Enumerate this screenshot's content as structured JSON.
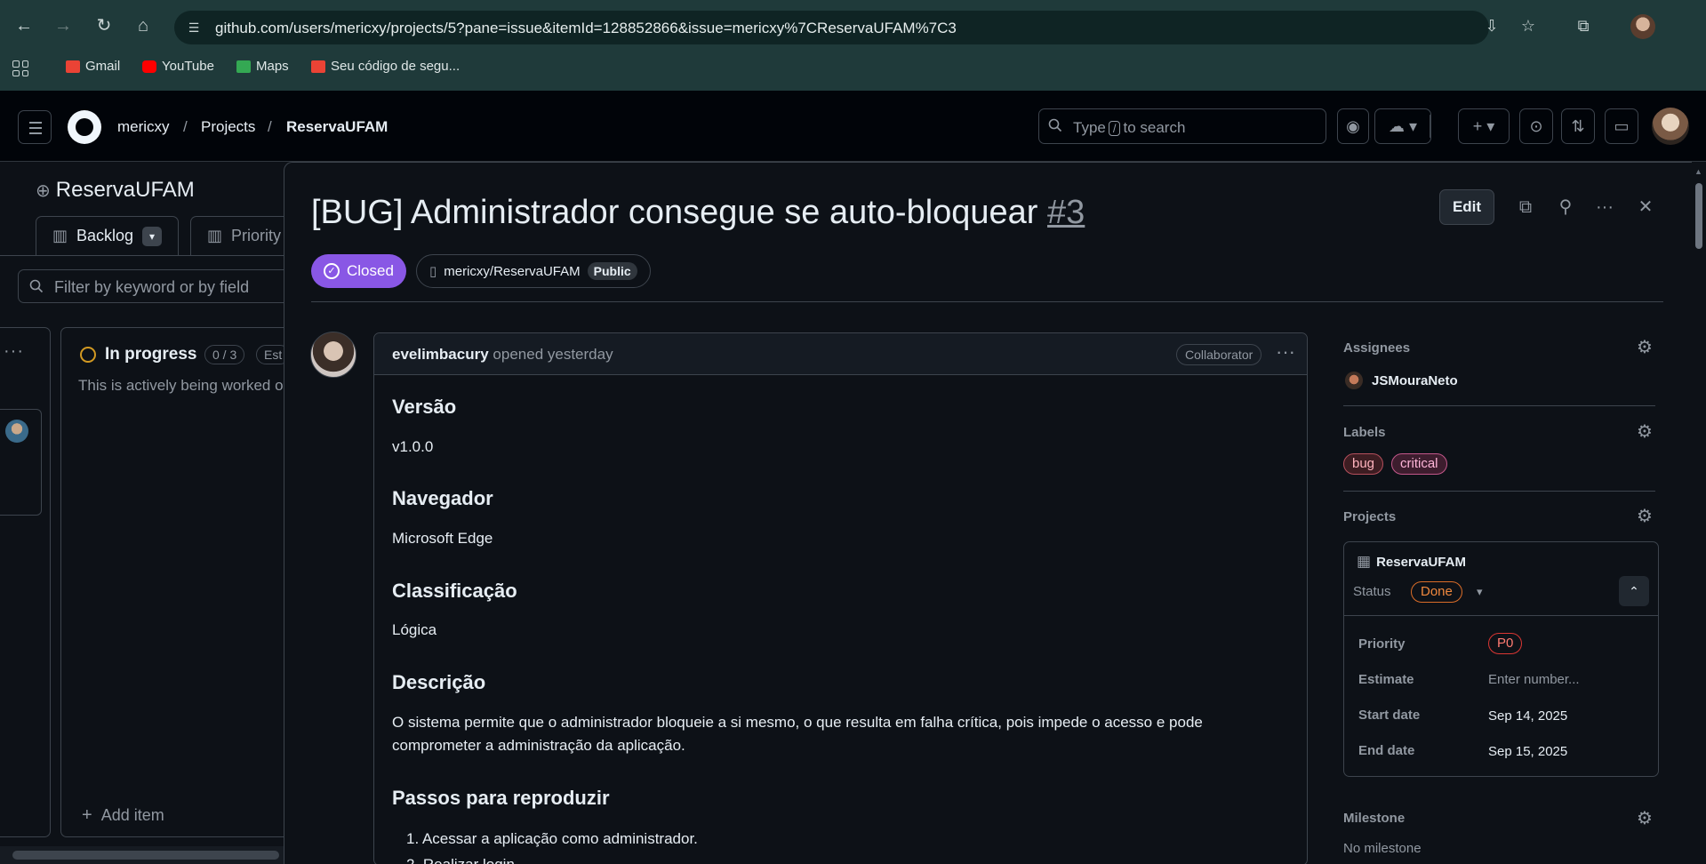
{
  "browser": {
    "url": "github.com/users/mericxy/projects/5?pane=issue&itemId=128852866&issue=mericxy%7CReservaUFAM%7C3",
    "bookmarks": [
      {
        "label": "Gmail",
        "color": "#ea4335"
      },
      {
        "label": "YouTube",
        "color": "#ff0000"
      },
      {
        "label": "Maps",
        "color": "#34a853"
      },
      {
        "label": "Seu código de segu...",
        "color": "#ea4335"
      }
    ]
  },
  "header": {
    "owner": "mericxy",
    "section": "Projects",
    "project": "ReservaUFAM",
    "search_prefix": "Type",
    "search_key": "/",
    "search_suffix": "to search"
  },
  "board": {
    "title": "ReservaUFAM",
    "tabs": [
      "Backlog",
      "Priority"
    ],
    "filter_placeholder": "Filter by keyword or by field",
    "column": {
      "name": "In progress",
      "count": "0 / 3",
      "estimate_pill": "Est",
      "description": "This is actively being worked o",
      "add_item": "Add item"
    }
  },
  "issue": {
    "title": "[BUG] Administrador consegue se auto-bloquear",
    "number": "#3",
    "edit_label": "Edit",
    "state": "Closed",
    "repo": "mericxy/ReservaUFAM",
    "visibility": "Public",
    "author": "evelimbacury",
    "opened": "opened yesterday",
    "author_role": "Collaborator",
    "sections": [
      {
        "heading": "Versão",
        "text": "v1.0.0"
      },
      {
        "heading": "Navegador",
        "text": "Microsoft Edge"
      },
      {
        "heading": "Classificação",
        "text": "Lógica"
      },
      {
        "heading": "Descrição",
        "text": "O sistema permite que o administrador bloqueie a si mesmo, o que resulta em falha crítica, pois impede o acesso e pode comprometer a administração da aplicação."
      },
      {
        "heading": "Passos para reproduzir",
        "text": ""
      }
    ],
    "steps": [
      "Acessar a aplicação como administrador.",
      "Realizar login."
    ]
  },
  "sidebar": {
    "assignees_label": "Assignees",
    "assignee": "JSMouraNeto",
    "labels_label": "Labels",
    "labels": [
      {
        "name": "bug",
        "bg": "#3d1d22",
        "border": "#b44f5c",
        "color": "#ffb3bd"
      },
      {
        "name": "critical",
        "bg": "#3d1d2e",
        "border": "#c2578a",
        "color": "#ffb6d9"
      }
    ],
    "projects_label": "Projects",
    "project": {
      "name": "ReservaUFAM",
      "status_label": "Status",
      "status": "Done",
      "fields": [
        {
          "name": "Priority",
          "value": "P0"
        },
        {
          "name": "Estimate",
          "value": "Enter number..."
        },
        {
          "name": "Start date",
          "value": "Sep 14, 2025"
        },
        {
          "name": "End date",
          "value": "Sep 15, 2025"
        }
      ]
    },
    "milestone_label": "Milestone",
    "milestone": "No milestone"
  }
}
